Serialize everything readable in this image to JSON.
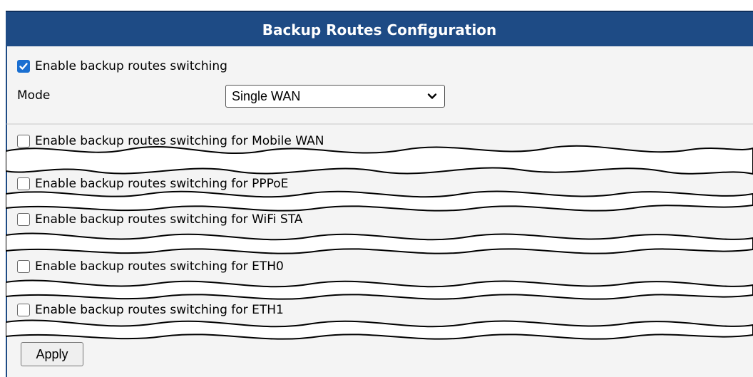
{
  "header": {
    "title": "Backup Routes Configuration"
  },
  "general": {
    "enable_label": "Enable backup routes switching",
    "enable_checked": true,
    "mode_label": "Mode",
    "mode_value": "Single WAN"
  },
  "interfaces": [
    {
      "label": "Enable backup routes switching for Mobile WAN",
      "checked": false
    },
    {
      "label": "Enable backup routes switching for PPPoE",
      "checked": false
    },
    {
      "label": "Enable backup routes switching for WiFi STA",
      "checked": false
    },
    {
      "label": "Enable backup routes switching for ETH0",
      "checked": false
    },
    {
      "label": "Enable backup routes switching for ETH1",
      "checked": false
    }
  ],
  "apply_label": "Apply",
  "colors": {
    "header_bg": "#1e4b85",
    "accent": "#1a6fd1",
    "panel_bg": "#f4f4f4"
  }
}
